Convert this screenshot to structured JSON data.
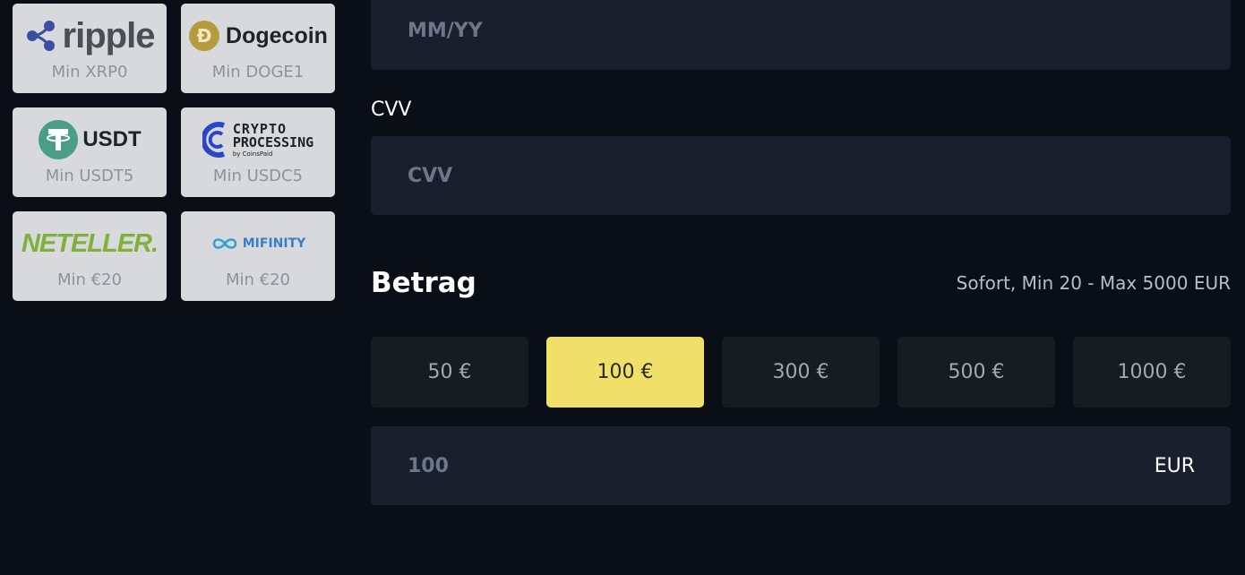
{
  "colors": {
    "background": "#0a0e17",
    "field_background": "#1a1f2e",
    "tile_background": "#d7d9dd",
    "selected_amount": "#f0e06a",
    "amount_button": "#171b22"
  },
  "payment_methods": [
    {
      "name": "ripple",
      "min": "Min XRP0",
      "icon": "ripple-icon"
    },
    {
      "name": "Dogecoin",
      "min": "Min DOGE1",
      "icon": "dogecoin-icon"
    },
    {
      "name": "USDT",
      "min": "Min USDT5",
      "icon": "tether-icon"
    },
    {
      "name_line1": "CRYPTO",
      "name_line2": "PROCESSING",
      "name_line3": "by CoinsPaid",
      "min": "Min USDC5",
      "icon": "crypto-processing-icon"
    },
    {
      "name": "NETELLER.",
      "min": "Min €20"
    },
    {
      "name": "MIFINITY",
      "min": "Min €20",
      "icon": "mifinity-infinity-icon"
    }
  ],
  "form": {
    "expiry_placeholder": "MM/YY",
    "cvv_label": "CVV",
    "cvv_placeholder": "CVV"
  },
  "amount": {
    "title": "Betrag",
    "limits": "Sofort, Min 20 - Max 5000 EUR",
    "presets": [
      "50 €",
      "100 €",
      "300 €",
      "500 €",
      "1000 €"
    ],
    "selected_preset": "100 €",
    "value": "100",
    "currency": "EUR"
  }
}
